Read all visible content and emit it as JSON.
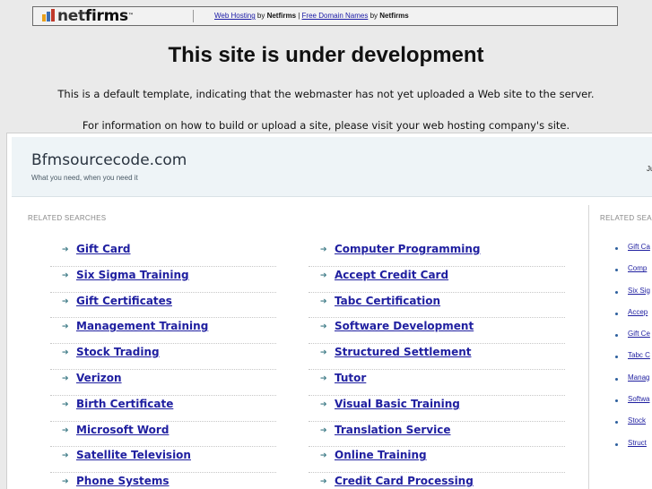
{
  "topbar": {
    "logo_net": "net",
    "logo_firms": "firms",
    "link1": "Web Hosting",
    "by1": " by ",
    "brand1": "Netfirms",
    "pipe": " | ",
    "link2": "Free Domain Names",
    "by2": " by ",
    "brand2": "Netfirms"
  },
  "heading": "This site is under development",
  "message1": "This is a default template, indicating that the webmaster has not yet uploaded a Web site to the server.",
  "message2": "For information on how to build or upload a site, please visit your web hosting company's site.",
  "parked": {
    "site_title": "Bfmsourcecode.com",
    "tagline": "What you need, when you need it",
    "date_partial": "Ju",
    "related_label": "RELATED SEARCHES",
    "side_label": "RELATED SEA",
    "left_links": [
      "Gift Card",
      "Six Sigma Training",
      "Gift Certificates",
      "Management Training",
      "Stock Trading",
      "Verizon",
      "Birth Certificate",
      "Microsoft Word",
      "Satellite Television",
      "Phone Systems"
    ],
    "right_links": [
      "Computer Programming",
      "Accept Credit Card",
      "Tabc Certification",
      "Software Development",
      "Structured Settlement",
      "Tutor",
      "Visual Basic Training",
      "Translation Service",
      "Online Training",
      "Credit Card Processing"
    ],
    "side_links": [
      "Gift Ca",
      "Comp",
      "Six Sig",
      "Accep",
      "Gift Ce",
      "Tabc C",
      "Manag",
      "Softwa",
      "Stock",
      "Struct"
    ],
    "arrow_glyph": "➔"
  },
  "colors": {
    "link": "#1f1fa0",
    "arrow": "#3d7a86",
    "header_bg": "#eef4f7",
    "page_bg": "#eaeaea"
  }
}
